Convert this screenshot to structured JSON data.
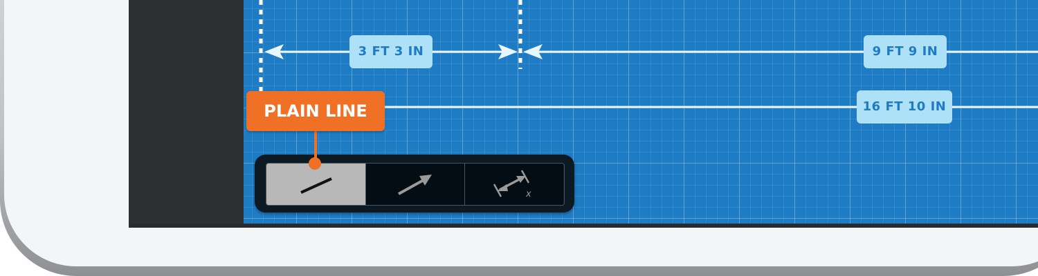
{
  "dimensions": {
    "segment_1": "3 FT 3 IN",
    "segment_2": "9 FT 9 IN",
    "total": "16 FT 10 IN"
  },
  "callout": {
    "label": "PLAIN LINE"
  },
  "toolbar": {
    "tools": [
      {
        "name": "plain-line",
        "icon": "plain-line-icon",
        "selected": true
      },
      {
        "name": "arrow-line",
        "icon": "arrow-line-icon",
        "selected": false
      },
      {
        "name": "dimension-line",
        "icon": "dimension-line-icon",
        "glyph": "x",
        "selected": false
      }
    ]
  },
  "colors": {
    "canvas": "#1e7cc4",
    "label_bg": "#aee0f7",
    "label_text": "#1e7cc4",
    "callout": "#f07126",
    "toolbar_bg": "#0d1a24",
    "tool_selected": "#b8b8b8"
  }
}
